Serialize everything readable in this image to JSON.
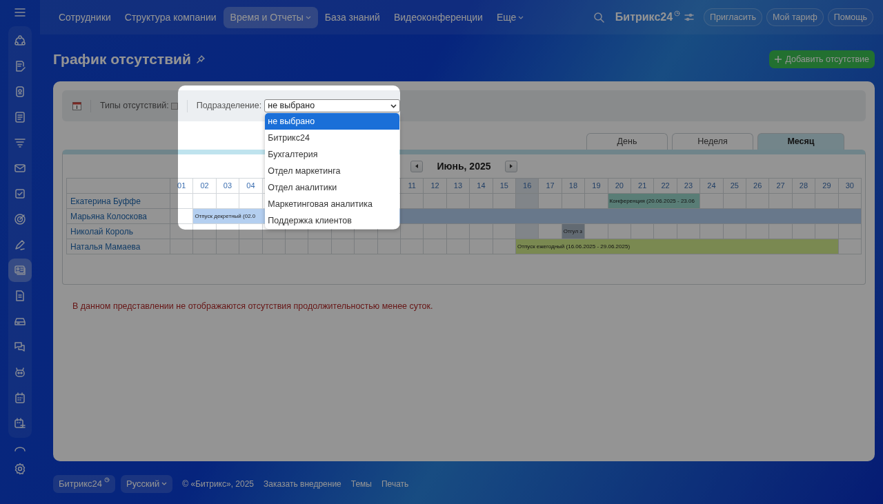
{
  "topnav": {
    "items": [
      {
        "label": "Сотрудники",
        "selected": false,
        "dropdown": false
      },
      {
        "label": "Структура компании",
        "selected": false,
        "dropdown": false
      },
      {
        "label": "Время и Отчеты",
        "selected": true,
        "dropdown": true
      },
      {
        "label": "База знаний",
        "selected": false,
        "dropdown": false
      },
      {
        "label": "Видеоконференции",
        "selected": false,
        "dropdown": false
      },
      {
        "label": "Еще",
        "selected": false,
        "dropdown": true
      }
    ]
  },
  "header": {
    "logo": "Битрикс24",
    "buttons": [
      "Пригласить",
      "Мой тариф",
      "Помощь"
    ]
  },
  "sidebar": {
    "items": [
      {
        "selected": false
      },
      {
        "selected": false
      },
      {
        "selected": false
      },
      {
        "selected": false
      },
      {
        "selected": false
      },
      {
        "selected": false
      },
      {
        "selected": false
      },
      {
        "selected": false
      },
      {
        "selected": false
      },
      {
        "selected": true
      },
      {
        "selected": false
      },
      {
        "selected": false
      },
      {
        "selected": false
      },
      {
        "selected": false
      },
      {
        "selected": false
      },
      {
        "selected": false
      }
    ]
  },
  "page": {
    "title": "График отсутствий",
    "add_button": "Добавить отсутствие"
  },
  "toolbar": {
    "types_label": "Типы отсутствий:",
    "types_checked": false,
    "department_label": "Подразделение:",
    "department_value": "не выбрано",
    "options": [
      {
        "label": "не выбрано",
        "selected": true
      },
      {
        "label": "Битрикс24",
        "selected": false
      },
      {
        "label": "Бухгалтерия",
        "selected": false
      },
      {
        "label": "Отдел маркетинга",
        "selected": false
      },
      {
        "label": "Отдел аналитики",
        "selected": false
      },
      {
        "label": "Маркетинговая аналитика",
        "selected": false
      },
      {
        "label": "Поддержка клиентов",
        "selected": false
      }
    ]
  },
  "view_tabs": [
    {
      "label": "День",
      "selected": false
    },
    {
      "label": "Неделя",
      "selected": false
    },
    {
      "label": "Месяц",
      "selected": true
    }
  ],
  "calendar": {
    "month": "Июнь, 2025",
    "days": [
      {
        "kind": "day",
        "label": "01",
        "today": false
      },
      {
        "kind": "day",
        "label": "02",
        "today": false
      },
      {
        "kind": "day",
        "label": "03",
        "today": false
      },
      {
        "kind": "day",
        "label": "04",
        "today": false
      },
      {
        "kind": "covered"
      },
      {
        "kind": "covered"
      },
      {
        "kind": "covered"
      },
      {
        "kind": "covered"
      },
      {
        "kind": "covered"
      },
      {
        "kind": "covered"
      },
      {
        "kind": "day",
        "label": "11",
        "today": false
      },
      {
        "kind": "day",
        "label": "12",
        "today": false
      },
      {
        "kind": "day",
        "label": "13",
        "today": false
      },
      {
        "kind": "day",
        "label": "14",
        "today": false
      },
      {
        "kind": "day",
        "label": "15",
        "today": false
      },
      {
        "kind": "day",
        "label": "16",
        "today": true
      },
      {
        "kind": "day",
        "label": "17",
        "today": false
      },
      {
        "kind": "day",
        "label": "18",
        "today": false
      },
      {
        "kind": "day",
        "label": "19",
        "today": false
      },
      {
        "kind": "day",
        "label": "20",
        "today": false
      },
      {
        "kind": "day",
        "label": "21",
        "today": false
      },
      {
        "kind": "day",
        "label": "22",
        "today": false
      },
      {
        "kind": "day",
        "label": "23",
        "today": false
      },
      {
        "kind": "day",
        "label": "24",
        "today": false
      },
      {
        "kind": "day",
        "label": "25",
        "today": false
      },
      {
        "kind": "day",
        "label": "26",
        "today": false
      },
      {
        "kind": "day",
        "label": "27",
        "today": false
      },
      {
        "kind": "day",
        "label": "28",
        "today": false
      },
      {
        "kind": "day",
        "label": "29",
        "today": false
      },
      {
        "kind": "day",
        "label": "30",
        "today": false
      }
    ],
    "people": [
      {
        "name": "Екатерина Буффе",
        "cells": [
          {
            "kind": "empty"
          },
          {
            "kind": "empty"
          },
          {
            "kind": "empty"
          },
          {
            "kind": "empty"
          },
          {
            "kind": "empty"
          },
          {
            "kind": "empty"
          },
          {
            "kind": "empty"
          },
          {
            "kind": "empty"
          },
          {
            "kind": "empty"
          },
          {
            "kind": "empty"
          },
          {
            "kind": "empty"
          },
          {
            "kind": "empty"
          },
          {
            "kind": "empty"
          },
          {
            "kind": "empty"
          },
          {
            "kind": "empty"
          },
          {
            "kind": "empty"
          },
          {
            "kind": "empty"
          },
          {
            "kind": "empty"
          },
          {
            "kind": "empty"
          },
          {
            "kind": "start",
            "text": "Конференция (20.06.2025 - 23.06",
            "color": "#597d76"
          },
          {
            "kind": "cont"
          },
          {
            "kind": "cont"
          },
          {
            "kind": "cont"
          },
          {
            "kind": "empty"
          },
          {
            "kind": "empty"
          },
          {
            "kind": "empty"
          },
          {
            "kind": "empty"
          },
          {
            "kind": "empty"
          },
          {
            "kind": "empty"
          },
          {
            "kind": "empty"
          }
        ]
      },
      {
        "name": "Марьяна Колоскова",
        "cells": [
          {
            "kind": "empty"
          },
          {
            "kind": "start",
            "text": "Отпуск декретный (02.0",
            "color": "#b4cff0"
          },
          {
            "kind": "cont"
          },
          {
            "kind": "cont"
          },
          {
            "kind": "cont"
          },
          {
            "kind": "cont"
          },
          {
            "kind": "cont"
          },
          {
            "kind": "cont"
          },
          {
            "kind": "cont"
          },
          {
            "kind": "cont"
          },
          {
            "kind": "cont"
          },
          {
            "kind": "cont"
          },
          {
            "kind": "cont"
          },
          {
            "kind": "cont"
          },
          {
            "kind": "cont"
          },
          {
            "kind": "cont"
          },
          {
            "kind": "cont"
          },
          {
            "kind": "cont"
          },
          {
            "kind": "cont"
          },
          {
            "kind": "cont"
          },
          {
            "kind": "cont"
          },
          {
            "kind": "cont"
          },
          {
            "kind": "cont"
          },
          {
            "kind": "cont"
          },
          {
            "kind": "cont"
          },
          {
            "kind": "cont"
          },
          {
            "kind": "cont"
          },
          {
            "kind": "cont"
          },
          {
            "kind": "cont"
          },
          {
            "kind": "cont"
          }
        ]
      },
      {
        "name": "Николай Король",
        "cells": [
          {
            "kind": "empty"
          },
          {
            "kind": "empty"
          },
          {
            "kind": "empty"
          },
          {
            "kind": "empty"
          },
          {
            "kind": "empty"
          },
          {
            "kind": "empty"
          },
          {
            "kind": "empty"
          },
          {
            "kind": "empty"
          },
          {
            "kind": "empty"
          },
          {
            "kind": "empty"
          },
          {
            "kind": "empty"
          },
          {
            "kind": "empty"
          },
          {
            "kind": "empty"
          },
          {
            "kind": "empty"
          },
          {
            "kind": "empty"
          },
          {
            "kind": "empty"
          },
          {
            "kind": "empty"
          },
          {
            "kind": "start",
            "text": "Отгул з",
            "color": "#626a72"
          },
          {
            "kind": "empty"
          },
          {
            "kind": "empty"
          },
          {
            "kind": "empty"
          },
          {
            "kind": "empty"
          },
          {
            "kind": "empty"
          },
          {
            "kind": "empty"
          },
          {
            "kind": "empty"
          },
          {
            "kind": "empty"
          },
          {
            "kind": "empty"
          },
          {
            "kind": "empty"
          },
          {
            "kind": "empty"
          },
          {
            "kind": "empty"
          }
        ]
      },
      {
        "name": "Наталья Мамаева",
        "cells": [
          {
            "kind": "empty"
          },
          {
            "kind": "empty"
          },
          {
            "kind": "empty"
          },
          {
            "kind": "empty"
          },
          {
            "kind": "empty"
          },
          {
            "kind": "empty"
          },
          {
            "kind": "empty"
          },
          {
            "kind": "empty"
          },
          {
            "kind": "empty"
          },
          {
            "kind": "empty"
          },
          {
            "kind": "empty"
          },
          {
            "kind": "empty"
          },
          {
            "kind": "empty"
          },
          {
            "kind": "empty"
          },
          {
            "kind": "empty"
          },
          {
            "kind": "start",
            "text": "Отпуск ежегодный (16.06.2025 - 29.06.2025)",
            "color": "#7a8951"
          },
          {
            "kind": "cont"
          },
          {
            "kind": "cont"
          },
          {
            "kind": "cont"
          },
          {
            "kind": "cont"
          },
          {
            "kind": "cont"
          },
          {
            "kind": "cont"
          },
          {
            "kind": "cont"
          },
          {
            "kind": "cont"
          },
          {
            "kind": "cont"
          },
          {
            "kind": "cont"
          },
          {
            "kind": "cont"
          },
          {
            "kind": "cont"
          },
          {
            "kind": "cont"
          },
          {
            "kind": "empty"
          }
        ]
      }
    ],
    "notice": "В данном представлении не отображаются отсутствия продолжительностью менее суток."
  },
  "footer": {
    "brand": "Битрикс24",
    "language": "Русский",
    "copyright": "© «Битрикс», 2025",
    "links": [
      "Заказать внедрение",
      "Темы",
      "Печать"
    ]
  }
}
